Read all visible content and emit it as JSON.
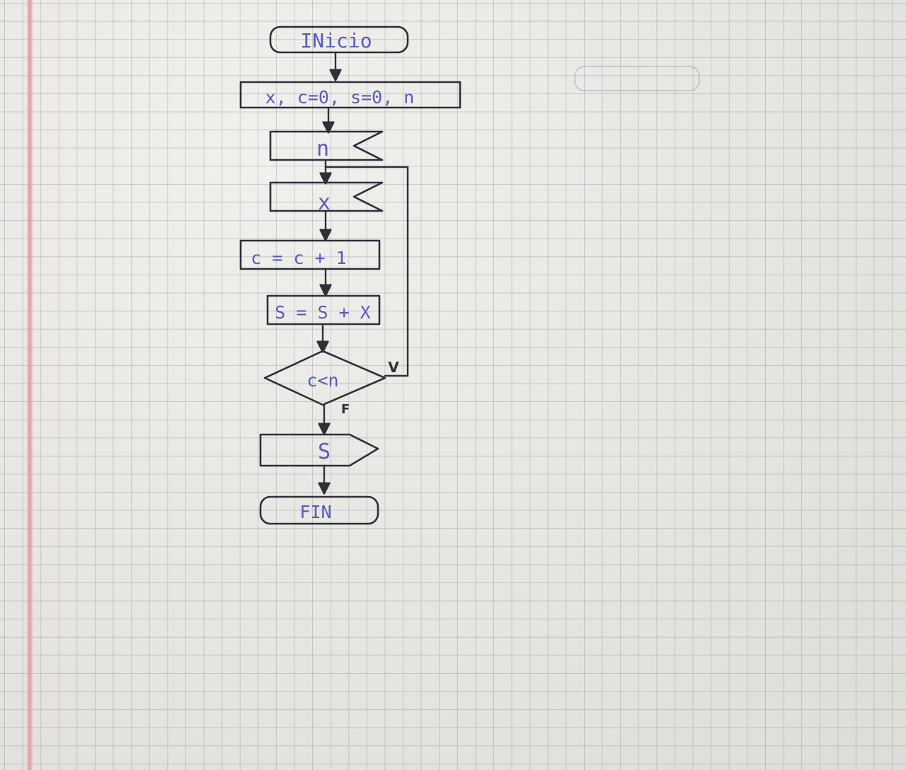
{
  "diagram": {
    "start_label": "INicio",
    "declare_label": "x, c=0, s=0, n",
    "input_n_label": "n",
    "input_x_label": "x",
    "increment_label": "c = c + 1",
    "sum_label": "S = S + X",
    "decision_label": "c<n",
    "true_label": "V",
    "false_label": "F",
    "output_label": "S",
    "end_label": "FIN"
  },
  "colors": {
    "paper": "#e9e8e3",
    "grid": "#8a8f99",
    "margin_line": "#e9a3a8",
    "ink_blue": "#5a5ab8",
    "pencil": "#2f2f35"
  }
}
